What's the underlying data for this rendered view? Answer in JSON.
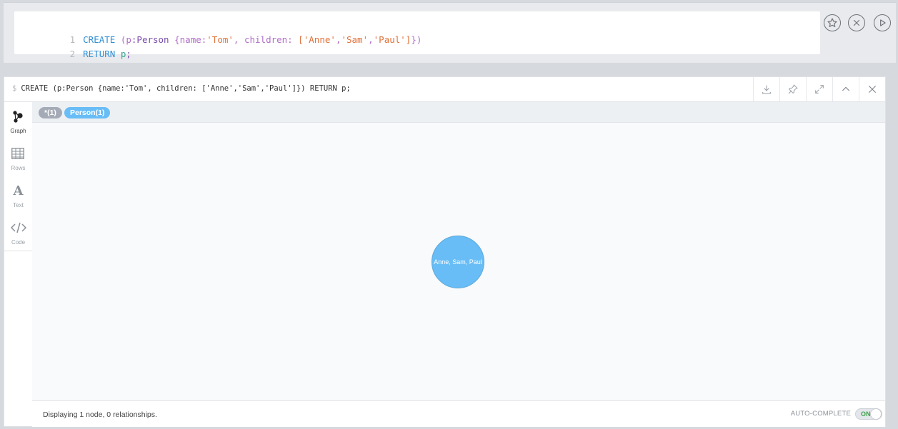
{
  "editor": {
    "lines": [
      {
        "num": "1"
      },
      {
        "num": "2"
      }
    ],
    "line1": {
      "kw": "CREATE",
      "p1": "(",
      "var": "p",
      "lbl": ":Person",
      "b1": "{name:",
      "s1": "'Tom'",
      "c1": ", children:",
      "br1": "[",
      "s2": "'Anne'",
      "cm1": ",",
      "s3": "'Sam'",
      "cm2": ",",
      "s4": "'Paul'",
      "br2": "]",
      "b2": "})"
    },
    "line2": {
      "kw": "RETURN",
      "var": "p",
      "semi": ";"
    },
    "buttons": [
      "star-icon",
      "close-circle-icon",
      "play-icon"
    ]
  },
  "frame": {
    "prompt": "$",
    "command": "CREATE (p:Person {name:'Tom', children: ['Anne','Sam','Paul']}) RETURN p;",
    "header_buttons": [
      "download-icon",
      "pin-icon",
      "expand-icon",
      "collapse-icon",
      "close-icon"
    ]
  },
  "sidebar": {
    "items": [
      {
        "label": "Graph",
        "icon": "graph-icon",
        "active": true
      },
      {
        "label": "Rows",
        "icon": "table-icon",
        "active": false
      },
      {
        "label": "Text",
        "icon": "text-icon",
        "active": false
      },
      {
        "label": "Code",
        "icon": "code-icon",
        "active": false
      }
    ]
  },
  "graph": {
    "labels": [
      {
        "text": "*(1)",
        "color": "#a5abb6"
      },
      {
        "text": "Person(1)",
        "color": "#68bdf6"
      }
    ],
    "node": {
      "caption": "Anne, Sam, Paul",
      "color": "#68bdf6"
    }
  },
  "footer": {
    "status": "Displaying 1 node, 0 relationships.",
    "autocomplete_label": "AUTO-COMPLETE",
    "toggle_state": "ON"
  }
}
